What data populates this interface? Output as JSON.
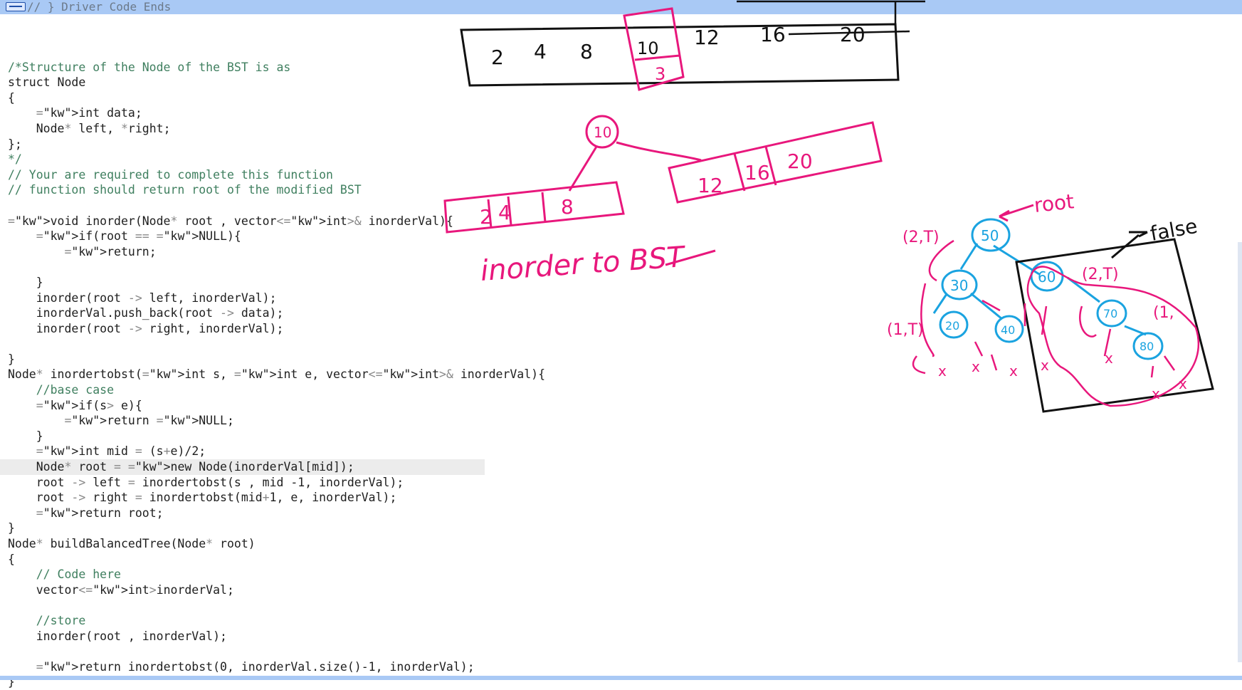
{
  "editor": {
    "top_line": "// } Driver Code Ends",
    "lines": [
      "",
      "/*Structure of the Node of the BST is as",
      "struct Node",
      "{",
      "    int data;",
      "    Node* left, *right;",
      "};",
      "*/",
      "// Your are required to complete this function",
      "// function should return root of the modified BST",
      "",
      "void inorder(Node* root , vector<int>& inorderVal){",
      "    if(root == NULL){",
      "        return;",
      "",
      "    }",
      "    inorder(root -> left, inorderVal);",
      "    inorderVal.push_back(root -> data);",
      "    inorder(root -> right, inorderVal);",
      "",
      "}",
      "Node* inordertobst(int s, int e, vector<int>& inorderVal){",
      "    //base case",
      "    if(s> e){",
      "        return NULL;",
      "    }",
      "    int mid = (s+e)/2;",
      "    Node* root = new Node(inorderVal[mid]);",
      "    root -> left = inordertobst(s , mid -1, inorderVal);",
      "    root -> right = inordertobst(mid+1, e, inorderVal);",
      "    return root;",
      "}",
      "Node* buildBalancedTree(Node* root)",
      "{",
      "    // Code here",
      "    vector<int>inorderVal;",
      "",
      "    //store",
      "    inorder(root , inorderVal);",
      "",
      "    return inordertobst(0, inorderVal.size()-1, inorderVal);",
      "}"
    ]
  },
  "annotations": {
    "array_top": [
      "2",
      "4",
      "8",
      "10",
      "12",
      "16",
      "20"
    ],
    "array_top_index": "3",
    "mid_node": "10",
    "left_array": [
      "2",
      "4",
      "8"
    ],
    "right_array": [
      "12",
      "16",
      "20"
    ],
    "caption": "inorder to BST",
    "root_label": "root",
    "false_label": "false",
    "tree_nodes": [
      "50",
      "30",
      "60",
      "20",
      "40",
      "70",
      "80"
    ],
    "pair_labels": [
      "(2,T)",
      "(2,T)",
      "(1,T)",
      "(1,"
    ]
  },
  "colors": {
    "pink": "#e8177c",
    "blue": "#1aa3e0",
    "black": "#111111",
    "topbar": "#a9c9f5"
  }
}
